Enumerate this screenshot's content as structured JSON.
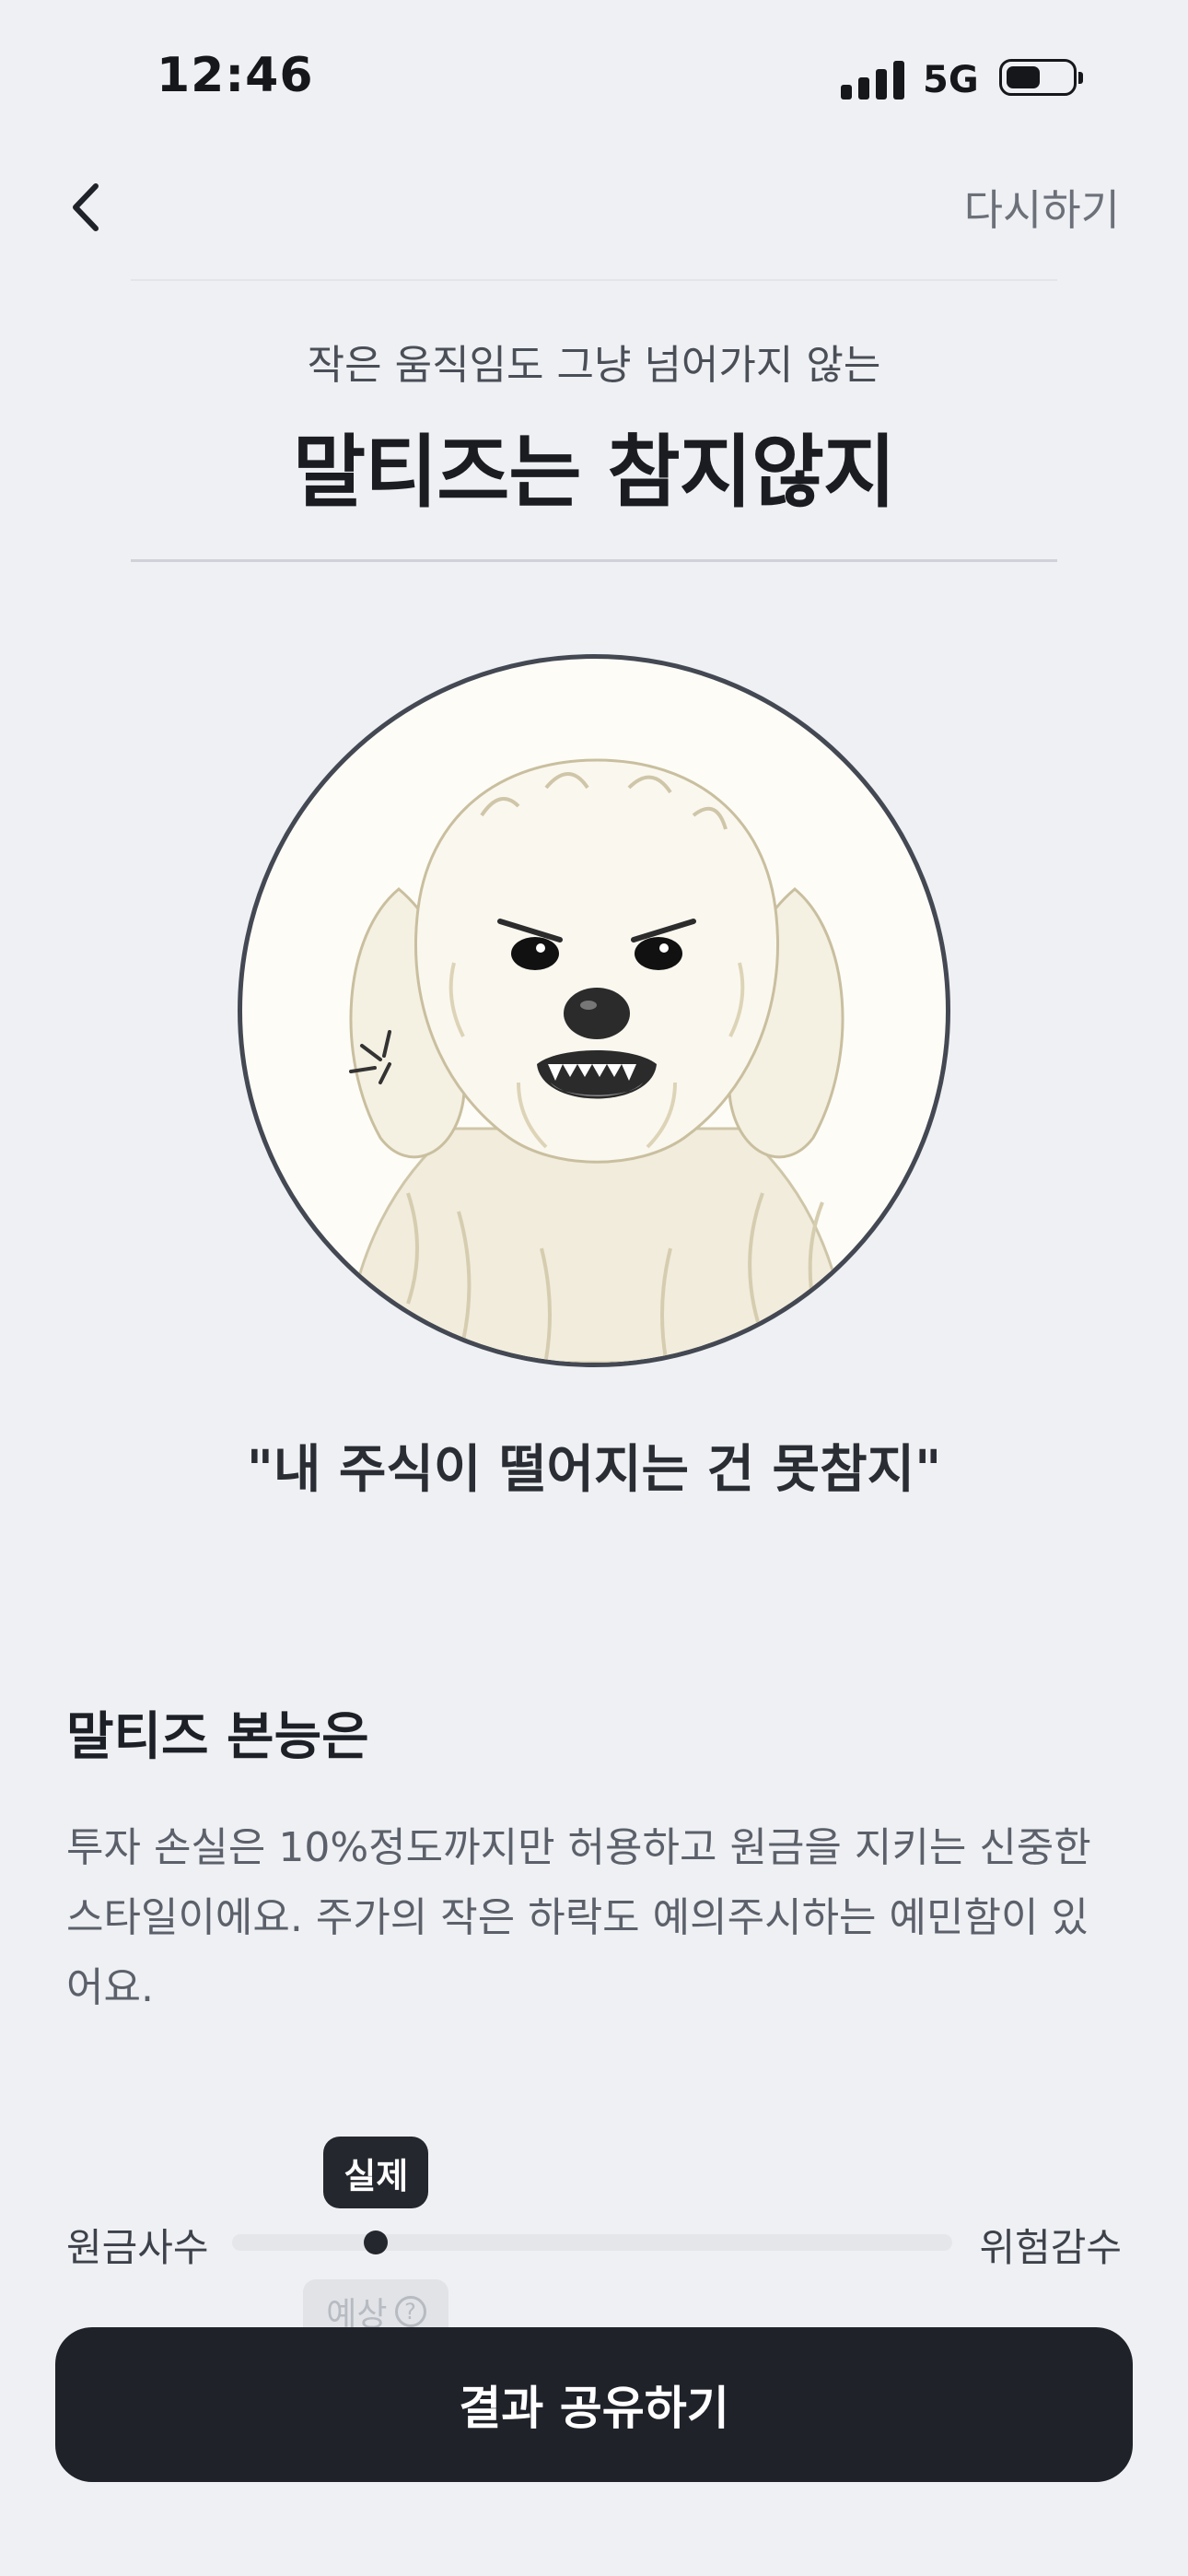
{
  "status_bar": {
    "time": "12:46",
    "network": "5G"
  },
  "nav": {
    "retry_label": "다시하기"
  },
  "header": {
    "subtitle": "작은 움직임도 그냥 넘어가지 않는",
    "title": "말티즈는 참지않지"
  },
  "portrait": {
    "icon": "angry-maltese-dog"
  },
  "quote": "\"내 주식이 떨어지는 건 못참지\"",
  "instinct": {
    "title": "말티즈 본능은",
    "description": "투자 손실은 10%정도까지만 허용하고 원금을 지키는 신중한 스타일이에요. 주가의 작은 하락도 예의주시하는 예민함이 있어요."
  },
  "risk_slider": {
    "left_label": "원금사수",
    "right_label": "위험감수",
    "actual_label": "실제",
    "expected_label": "예상",
    "help_symbol": "?",
    "actual_fraction": 0.2
  },
  "share_button": "결과 공유하기",
  "colors": {
    "dark": "#1f2229",
    "background": "#eef0f3",
    "muted": "#5b606a"
  }
}
